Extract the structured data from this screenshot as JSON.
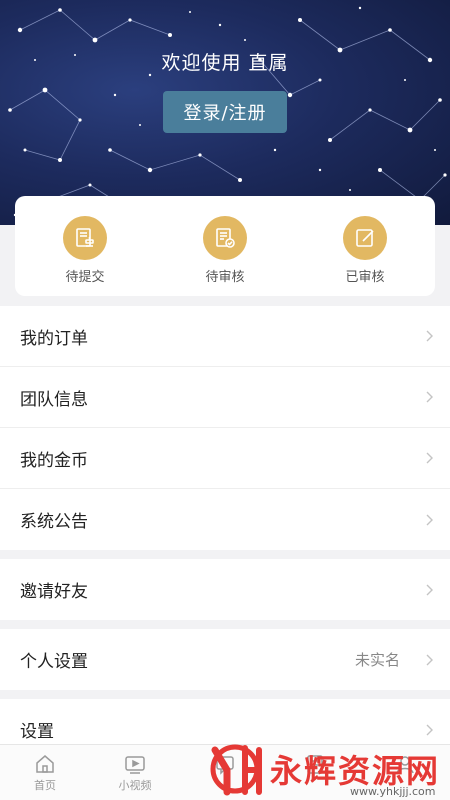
{
  "header": {
    "welcome_text": "欢迎使用 直属",
    "login_label": "登录/注册"
  },
  "status": [
    {
      "label": "待提交",
      "icon": "document-stamp-icon"
    },
    {
      "label": "待审核",
      "icon": "document-check-icon"
    },
    {
      "label": "已审核",
      "icon": "edit-icon"
    }
  ],
  "menu": {
    "group1": [
      {
        "label": "我的订单"
      },
      {
        "label": "团队信息"
      },
      {
        "label": "我的金币"
      },
      {
        "label": "系统公告"
      }
    ],
    "invite": {
      "label": "邀请好友"
    },
    "personal": {
      "label": "个人设置",
      "value": "未实名"
    },
    "settings": {
      "label": "设置"
    }
  },
  "tabbar": [
    {
      "label": "首页",
      "icon": "home-icon"
    },
    {
      "label": "小视频",
      "icon": "video-icon"
    },
    {
      "label": "",
      "icon": "chat-icon"
    },
    {
      "label": "",
      "icon": "tasks-icon"
    },
    {
      "label": "",
      "icon": "profile-icon"
    }
  ],
  "watermark": {
    "text": "永辉资源网",
    "url": "www.yhkjjj.com"
  },
  "colors": {
    "accent_gold": "#e2b862",
    "login_button": "#4a7e9b",
    "hero_bg": "#1d2b5e",
    "watermark_red": "#e53935"
  }
}
